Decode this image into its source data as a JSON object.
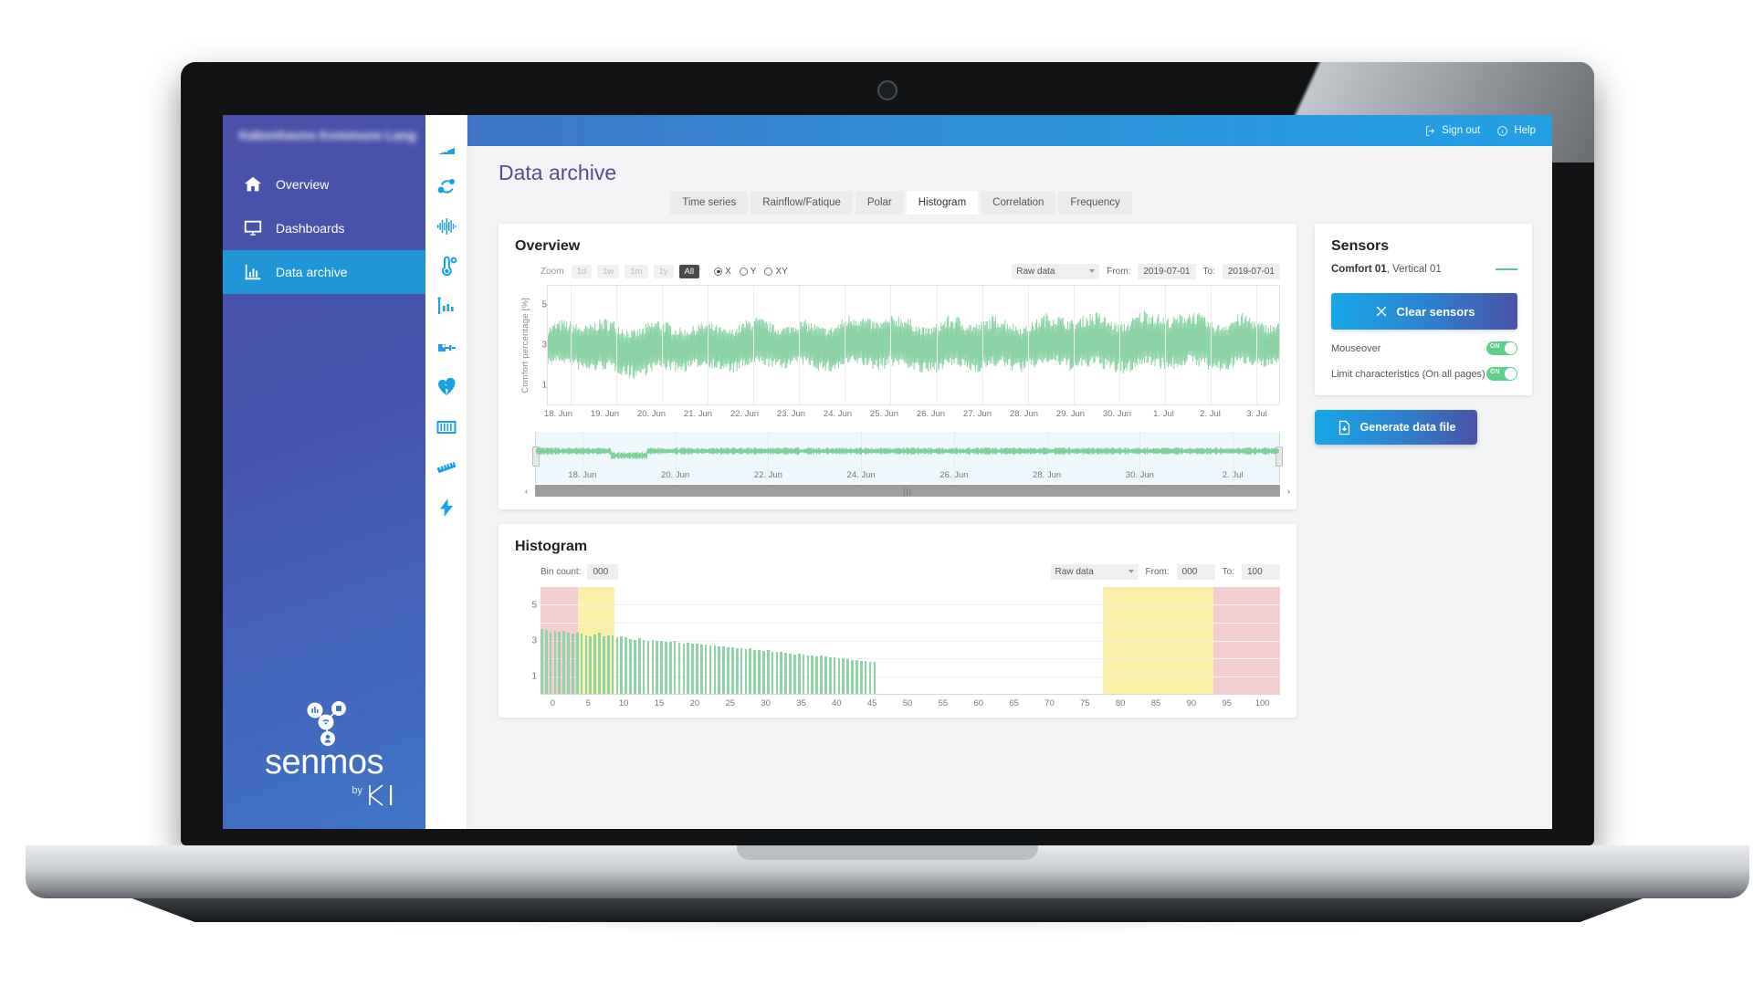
{
  "app": {
    "org_title": "Københavns Kommune Langebro",
    "page_title": "Data archive"
  },
  "topbar": {
    "sign_out": "Sign out",
    "help": "Help",
    "sign_out_icon": "sign-out-icon",
    "help_icon": "info-circle-icon"
  },
  "sidebar": {
    "items": [
      {
        "label": "Overview",
        "icon": "home-icon",
        "active": false
      },
      {
        "label": "Dashboards",
        "icon": "monitor-icon",
        "active": false
      },
      {
        "label": "Data archive",
        "icon": "bar-chart-icon",
        "active": true
      }
    ],
    "logo": {
      "word": "senmos",
      "by": "by",
      "brand": "KI"
    }
  },
  "rail": {
    "icons": [
      "angle-ruler-icon",
      "route-icon",
      "waveform-icon",
      "thermometer-icon",
      "levels-icon",
      "pressure-sensor-icon",
      "broken-heart-icon",
      "grid-barrier-icon",
      "ruler-icon",
      "lightning-icon"
    ]
  },
  "tabs": [
    {
      "label": "Time series",
      "active": false
    },
    {
      "label": "Rainflow/Fatique",
      "active": false
    },
    {
      "label": "Polar",
      "active": false
    },
    {
      "label": "Histogram",
      "active": true
    },
    {
      "label": "Correlation",
      "active": false
    },
    {
      "label": "Frequency",
      "active": false
    }
  ],
  "overview": {
    "title": "Overview",
    "toolbar": {
      "zoom_label": "Zoom",
      "zoom_buttons": [
        {
          "label": "1d",
          "active": false
        },
        {
          "label": "1w",
          "active": false
        },
        {
          "label": "1m",
          "active": false
        },
        {
          "label": "1y",
          "active": false
        },
        {
          "label": "All",
          "active": true
        }
      ],
      "axis_radios": [
        {
          "label": "X",
          "selected": true
        },
        {
          "label": "Y",
          "selected": false
        },
        {
          "label": "XY",
          "selected": false
        }
      ],
      "dataset": "Raw data",
      "from_label": "From:",
      "from_value": "2019-07-01",
      "to_label": "To:",
      "to_value": "2019-07-01"
    },
    "navigator": {
      "scroll_left": "‹",
      "scroll_right": "›",
      "grip": "|||"
    }
  },
  "histogram": {
    "title": "Histogram",
    "toolbar": {
      "bin_count_label": "Bin count:",
      "bin_count_value": "000",
      "dataset": "Raw data",
      "from_label": "From:",
      "from_value": "000",
      "to_label": "To:",
      "to_value": "100"
    }
  },
  "sensors": {
    "title": "Sensors",
    "entries": [
      {
        "name": "Comfort 01",
        "channel": ", Vertical 01",
        "color": "#5cc98c"
      }
    ],
    "clear_button": "Clear sensors",
    "clear_icon": "close-x-icon",
    "toggles": [
      {
        "label": "Mouseover",
        "state": "ON"
      },
      {
        "label": "Limit characteristics (On all pages)",
        "state": "ON"
      }
    ]
  },
  "actions": {
    "generate_label": "Generate data file",
    "generate_icon": "file-download-icon"
  },
  "colors": {
    "accent_blue": "#18a0e8",
    "nav_purple": "#4a51a8",
    "series_green": "#7fcf9b",
    "band_yellow": "#fbf0a8",
    "band_pink": "#f3cdd0"
  },
  "chart_data": [
    {
      "type": "line",
      "name": "overview-timeseries",
      "title": "Overview",
      "ylabel": "Comfort percentage [%]",
      "xlabel": "",
      "ylim": [
        0,
        6
      ],
      "yticks": [
        1,
        3,
        5
      ],
      "grid": true,
      "legend": "Comfort 01, Vertical 01",
      "series_color": "#7fcf9b",
      "xticks": [
        "18. Jun",
        "19. Jun",
        "20. Jun",
        "21. Jun",
        "22. Jun",
        "23. Jun",
        "24. Jun",
        "25. Jun",
        "26. Jun",
        "27. Jun",
        "28. Jun",
        "29. Jun",
        "30. Jun",
        "1. Jul",
        "2. Jul",
        "3. Jul"
      ],
      "description": "Dense oscillating comfort-percentage signal spanning 18 June to 3 July, values ranging roughly 1.0 to 5.2 with daily cycles.",
      "envelope_min": [
        1.8,
        1.4,
        1.2,
        1.6,
        1.5,
        1.7,
        1.5,
        1.6,
        1.4,
        1.5,
        1.6,
        1.5,
        1.4,
        1.6,
        1.5,
        1.7
      ],
      "envelope_max": [
        4.2,
        4.6,
        4.4,
        4.3,
        4.5,
        4.4,
        4.6,
        4.8,
        4.5,
        4.7,
        4.6,
        4.9,
        4.8,
        5.0,
        4.7,
        4.5
      ]
    },
    {
      "type": "line",
      "name": "overview-navigator",
      "title": "",
      "ylabel": "",
      "xlabel": "",
      "grid": true,
      "series_color": "#7fcf9b",
      "xticks": [
        "18. Jun",
        "20. Jun",
        "22. Jun",
        "24. Jun",
        "26. Jun",
        "28. Jun",
        "30. Jun",
        "2. Jul"
      ],
      "description": "Compressed navigator view of the same comfort signal across the full range."
    },
    {
      "type": "bar",
      "name": "histogram",
      "title": "Histogram",
      "xlabel": "",
      "ylabel": "",
      "ylim": [
        0,
        6
      ],
      "yticks": [
        1,
        3,
        5
      ],
      "xlim": [
        0,
        100
      ],
      "xticks": [
        0,
        5,
        10,
        15,
        20,
        25,
        30,
        35,
        40,
        45,
        50,
        55,
        60,
        65,
        70,
        75,
        80,
        85,
        90,
        95,
        100
      ],
      "grid": true,
      "bar_color": "#8fd3a6",
      "bands": [
        {
          "from": 0,
          "to": 5,
          "color": "#f3cdd0"
        },
        {
          "from": 5,
          "to": 10,
          "color": "#fbf0a8"
        },
        {
          "from": 76,
          "to": 91,
          "color": "#fbf0a8"
        },
        {
          "from": 91,
          "to": 100,
          "color": "#f3cdd0"
        }
      ],
      "categories": [
        0,
        0.6,
        1.2,
        1.8,
        2.4,
        3,
        3.6,
        4.2,
        4.8,
        5.4,
        6,
        6.6,
        7.2,
        7.8,
        8.4,
        9,
        9.6,
        10.2,
        10.8,
        11.4,
        12,
        12.6,
        13.2,
        13.8,
        14.4,
        15,
        15.6,
        16.2,
        16.8,
        17.4,
        18,
        18.6,
        19.2,
        19.8,
        20.4,
        21,
        21.6,
        22.2,
        22.8,
        23.4,
        24,
        24.6,
        25.2,
        25.8,
        26.4,
        27,
        27.6,
        28.2,
        28.8,
        29.4,
        30,
        30.6,
        31.2,
        31.8,
        32.4,
        33,
        33.6,
        34.2,
        34.8,
        35.4,
        36,
        36.6,
        37.2,
        37.8,
        38.4,
        39,
        39.6,
        40.2,
        40.8,
        41.4,
        42,
        42.6,
        43.2,
        43.8,
        44.4,
        45
      ],
      "values": [
        3.62,
        3.58,
        3.45,
        3.52,
        3.48,
        3.55,
        3.44,
        3.4,
        3.42,
        3.38,
        3.3,
        3.25,
        3.35,
        3.42,
        3.22,
        3.28,
        3.26,
        3.2,
        3.24,
        3.18,
        3.1,
        3.05,
        3.12,
        3.02,
        2.98,
        3.04,
        2.96,
        3.0,
        2.92,
        2.9,
        2.95,
        2.88,
        2.82,
        2.86,
        2.8,
        2.84,
        2.76,
        2.78,
        2.7,
        2.74,
        2.68,
        2.66,
        2.62,
        2.64,
        2.58,
        2.56,
        2.52,
        2.54,
        2.48,
        2.46,
        2.42,
        2.44,
        2.38,
        2.34,
        2.36,
        2.3,
        2.26,
        2.22,
        2.28,
        2.2,
        2.16,
        2.18,
        2.12,
        2.14,
        2.08,
        2.04,
        2.06,
        2.0,
        1.98,
        1.96,
        1.9,
        1.92,
        1.86,
        1.84,
        1.82,
        1.78
      ]
    }
  ]
}
